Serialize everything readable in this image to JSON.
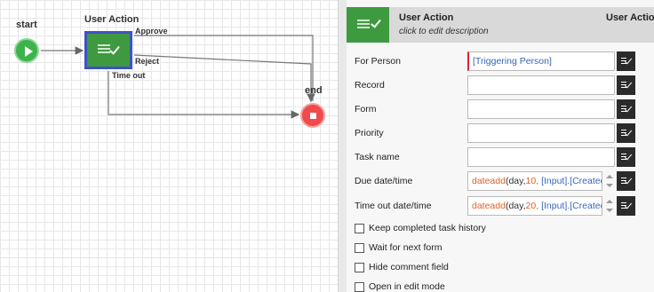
{
  "canvas": {
    "start_label": "start",
    "end_label": "end",
    "user_action_label": "User Action",
    "edges": {
      "approve": "Approve",
      "reject": "Reject",
      "timeout": "Time out"
    }
  },
  "panel": {
    "header": {
      "title": "User Action",
      "description": "click to edit description",
      "right_title": "User Action"
    },
    "fields": [
      {
        "label": "For Person",
        "value": "[Triggering Person]"
      },
      {
        "label": "Record",
        "value": ""
      },
      {
        "label": "Form",
        "value": ""
      },
      {
        "label": "Priority",
        "value": ""
      },
      {
        "label": "Task name",
        "value": ""
      },
      {
        "label": "Due date/time",
        "expr_fn": "dateadd",
        "expr_args": "(day,",
        "expr_num": "10,",
        "expr_ref": "[Input].[Created"
      },
      {
        "label": "Time out date/time",
        "expr_fn": "dateadd",
        "expr_args": "(day,",
        "expr_num": "20,",
        "expr_ref": "[Input].[Created"
      }
    ],
    "checkboxes": [
      {
        "label": "Keep completed task history",
        "checked": false
      },
      {
        "label": "Wait for next form",
        "checked": false
      },
      {
        "label": "Hide comment field",
        "checked": false
      },
      {
        "label": "Open in edit mode",
        "checked": false
      }
    ]
  }
}
